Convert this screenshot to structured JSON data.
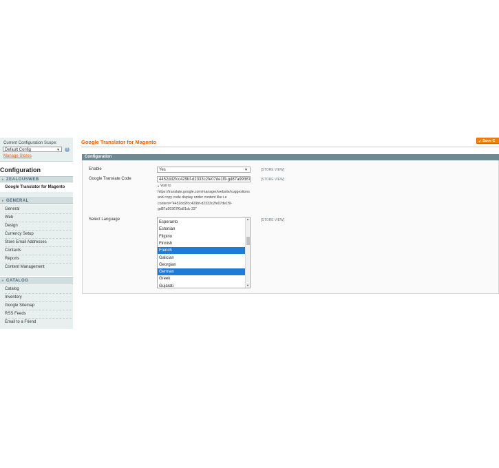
{
  "sidebar": {
    "scope_label": "Current Configuration Scope:",
    "scope_value": "Default Config",
    "manage_stores": "Manage Stores",
    "title": "Configuration",
    "sections": [
      {
        "label": "ZEALOUSWEB",
        "items": [
          "Google Translator for Magento"
        ]
      },
      {
        "label": "GENERAL",
        "items": [
          "General",
          "Web",
          "Design",
          "Currency Setup",
          "Store Email Addresses",
          "Contacts",
          "Reports",
          "Content Management"
        ]
      },
      {
        "label": "CATALOG",
        "items": [
          "Catalog",
          "Inventory",
          "Google Sitemap",
          "RSS Feeds",
          "Email to a Friend"
        ]
      }
    ]
  },
  "main": {
    "title": "Google Translator for Magento",
    "save_label": "Save C",
    "panel_title": "Configuration",
    "fields": {
      "enable": {
        "label": "Enable",
        "value": "Yes",
        "scope": "[STORE VIEW]"
      },
      "code": {
        "label": "Google Translate Code",
        "value": "4452dd2fcc429bf-d2333c2fe07de1f9-gd87a99367",
        "scope": "[STORE VIEW]"
      },
      "note": [
        "Visit to",
        "https://translate.google.com/manager/website/suggestions",
        "and copy code display under content like i.e",
        "content=\"4452dd2fcc429bf-d2333c2fe07de1f9-",
        "gd87a99367f0a81dc-33\""
      ],
      "language": {
        "label": "Select Language",
        "scope": "[STORE VIEW]",
        "options": [
          {
            "name": "Esperanto",
            "selected": false
          },
          {
            "name": "Estonian",
            "selected": false
          },
          {
            "name": "Filipino",
            "selected": false
          },
          {
            "name": "Finnish",
            "selected": false
          },
          {
            "name": "French",
            "selected": true
          },
          {
            "name": "Galician",
            "selected": false
          },
          {
            "name": "Georgian",
            "selected": false
          },
          {
            "name": "German",
            "selected": true
          },
          {
            "name": "Greek",
            "selected": false
          },
          {
            "name": "Gujarati",
            "selected": false
          }
        ]
      }
    }
  },
  "colors": {
    "accent": "#eb5e00",
    "selection": "#1e7bd6",
    "panel_header": "#6f8992",
    "sidebar_bg": "#e7efef"
  }
}
